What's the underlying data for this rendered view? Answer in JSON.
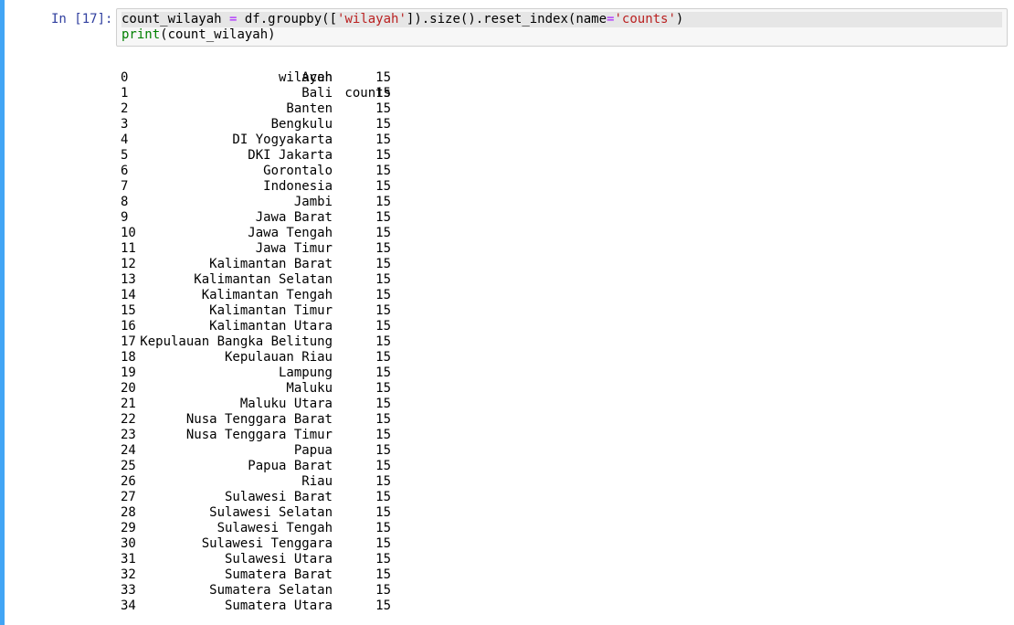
{
  "cell": {
    "prompt": "In [17]:",
    "code_line1": {
      "var": "count_wilayah ",
      "eq": "=",
      "call_a": " df.groupby([",
      "str1": "'wilayah'",
      "call_b": "]).size().reset_index(name",
      "eq2": "=",
      "str2": "'counts'",
      "close": ")"
    },
    "code_line2": {
      "builtin": "print",
      "rest": "(count_wilayah)"
    }
  },
  "output": {
    "headers": {
      "wilayah": "wilayah",
      "counts": "counts"
    },
    "rows": [
      {
        "idx": "0",
        "wilayah": "Aceh",
        "counts": "15"
      },
      {
        "idx": "1",
        "wilayah": "Bali",
        "counts": "15"
      },
      {
        "idx": "2",
        "wilayah": "Banten",
        "counts": "15"
      },
      {
        "idx": "3",
        "wilayah": "Bengkulu",
        "counts": "15"
      },
      {
        "idx": "4",
        "wilayah": "DI Yogyakarta",
        "counts": "15"
      },
      {
        "idx": "5",
        "wilayah": "DKI Jakarta",
        "counts": "15"
      },
      {
        "idx": "6",
        "wilayah": "Gorontalo",
        "counts": "15"
      },
      {
        "idx": "7",
        "wilayah": "Indonesia",
        "counts": "15"
      },
      {
        "idx": "8",
        "wilayah": "Jambi",
        "counts": "15"
      },
      {
        "idx": "9",
        "wilayah": "Jawa Barat",
        "counts": "15"
      },
      {
        "idx": "10",
        "wilayah": "Jawa Tengah",
        "counts": "15"
      },
      {
        "idx": "11",
        "wilayah": "Jawa Timur",
        "counts": "15"
      },
      {
        "idx": "12",
        "wilayah": "Kalimantan Barat",
        "counts": "15"
      },
      {
        "idx": "13",
        "wilayah": "Kalimantan Selatan",
        "counts": "15"
      },
      {
        "idx": "14",
        "wilayah": "Kalimantan Tengah",
        "counts": "15"
      },
      {
        "idx": "15",
        "wilayah": "Kalimantan Timur",
        "counts": "15"
      },
      {
        "idx": "16",
        "wilayah": "Kalimantan Utara",
        "counts": "15"
      },
      {
        "idx": "17",
        "wilayah": "Kepulauan Bangka Belitung",
        "counts": "15"
      },
      {
        "idx": "18",
        "wilayah": "Kepulauan Riau",
        "counts": "15"
      },
      {
        "idx": "19",
        "wilayah": "Lampung",
        "counts": "15"
      },
      {
        "idx": "20",
        "wilayah": "Maluku",
        "counts": "15"
      },
      {
        "idx": "21",
        "wilayah": "Maluku Utara",
        "counts": "15"
      },
      {
        "idx": "22",
        "wilayah": "Nusa Tenggara Barat",
        "counts": "15"
      },
      {
        "idx": "23",
        "wilayah": "Nusa Tenggara Timur",
        "counts": "15"
      },
      {
        "idx": "24",
        "wilayah": "Papua",
        "counts": "15"
      },
      {
        "idx": "25",
        "wilayah": "Papua Barat",
        "counts": "15"
      },
      {
        "idx": "26",
        "wilayah": "Riau",
        "counts": "15"
      },
      {
        "idx": "27",
        "wilayah": "Sulawesi Barat",
        "counts": "15"
      },
      {
        "idx": "28",
        "wilayah": "Sulawesi Selatan",
        "counts": "15"
      },
      {
        "idx": "29",
        "wilayah": "Sulawesi Tengah",
        "counts": "15"
      },
      {
        "idx": "30",
        "wilayah": "Sulawesi Tenggara",
        "counts": "15"
      },
      {
        "idx": "31",
        "wilayah": "Sulawesi Utara",
        "counts": "15"
      },
      {
        "idx": "32",
        "wilayah": "Sumatera Barat",
        "counts": "15"
      },
      {
        "idx": "33",
        "wilayah": "Sumatera Selatan",
        "counts": "15"
      },
      {
        "idx": "34",
        "wilayah": "Sumatera Utara",
        "counts": "15"
      }
    ]
  },
  "colors": {
    "cell_bar": "#42a5f5",
    "prompt": "#303f9f",
    "keyword_op": "#aa22ff",
    "string": "#ba2121",
    "builtin": "#008000"
  }
}
